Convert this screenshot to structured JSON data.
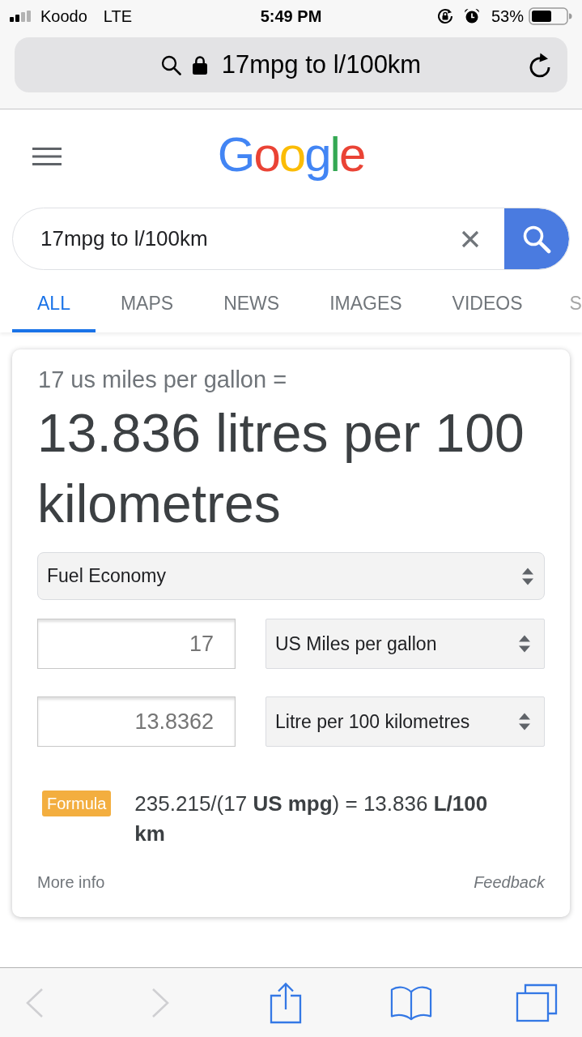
{
  "status_bar": {
    "carrier": "Koodo",
    "network": "LTE",
    "time": "5:49 PM",
    "battery": "53%"
  },
  "address_bar": {
    "text": "17mpg to l/100km"
  },
  "header": {
    "logo": "Google"
  },
  "search": {
    "value": "17mpg to l/100km"
  },
  "tabs": [
    {
      "label": "ALL",
      "selected": true
    },
    {
      "label": "MAPS",
      "selected": false
    },
    {
      "label": "NEWS",
      "selected": false
    },
    {
      "label": "IMAGES",
      "selected": false
    },
    {
      "label": "VIDEOS",
      "selected": false
    },
    {
      "label": "S",
      "selected": false
    }
  ],
  "converter": {
    "query": "17 us miles per gallon =",
    "result": "13.836 litres per 100 kilometres",
    "category": "Fuel Economy",
    "from": {
      "value": "17",
      "unit": "US Miles per gallon"
    },
    "to": {
      "value": "13.8362",
      "unit": "Litre per 100 kilometres"
    },
    "formula_label": "Formula",
    "formula": "235.215/(17 **US mpg**) = 13.836 **L/100 km**",
    "more_info": "More info",
    "feedback": "Feedback"
  },
  "toolbar": [
    {
      "kind": "back",
      "disabled": true
    },
    {
      "kind": "forward",
      "disabled": true
    },
    {
      "kind": "share",
      "disabled": false
    },
    {
      "kind": "bookmarks",
      "disabled": false
    },
    {
      "kind": "tabs",
      "disabled": false
    }
  ]
}
